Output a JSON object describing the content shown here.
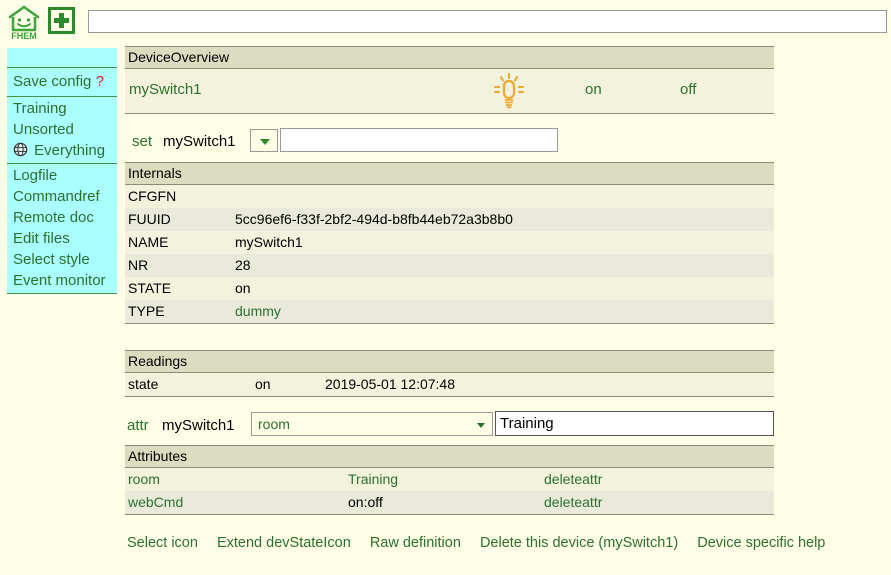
{
  "topbar": {
    "logo_text": "FHEM",
    "logo_icon": "fhem-house-smiley-icon",
    "add_icon": "plus-icon",
    "command_input_value": "",
    "command_input_placeholder": ""
  },
  "sidebar": {
    "save": {
      "label": "Save config",
      "help": "?"
    },
    "rooms": [
      {
        "label": "Training",
        "icon": ""
      },
      {
        "label": "Unsorted",
        "icon": ""
      },
      {
        "label": "Everything",
        "icon": "globe-icon"
      }
    ],
    "tools": [
      {
        "label": "Logfile"
      },
      {
        "label": "Commandref"
      },
      {
        "label": "Remote doc"
      },
      {
        "label": "Edit files"
      },
      {
        "label": "Select style"
      },
      {
        "label": "Event monitor"
      }
    ]
  },
  "device_overview": {
    "title": "DeviceOverview",
    "device_name": "mySwitch1",
    "state_icon": "lightbulb-on-icon",
    "state_icon_color": "#f0a830",
    "commands": [
      {
        "label": "on"
      },
      {
        "label": "off"
      }
    ]
  },
  "set_row": {
    "keyword": "set",
    "device_name": "mySwitch1",
    "select_value": "",
    "input_value": "",
    "input_placeholder": ""
  },
  "internals": {
    "title": "Internals",
    "rows": [
      {
        "key": "CFGFN",
        "value": ""
      },
      {
        "key": "FUUID",
        "value": "5cc96ef6-f33f-2bf2-494d-b8fb44eb72a3b8b0"
      },
      {
        "key": "NAME",
        "value": "mySwitch1"
      },
      {
        "key": "NR",
        "value": "28"
      },
      {
        "key": "STATE",
        "value": "on"
      },
      {
        "key": "TYPE",
        "value": "dummy"
      }
    ]
  },
  "readings": {
    "title": "Readings",
    "rows": [
      {
        "name": "state",
        "value": "on",
        "timestamp": "2019-05-01 12:07:48"
      }
    ]
  },
  "attr_row": {
    "keyword": "attr",
    "device_name": "mySwitch1",
    "select_value": "room",
    "input_value": "Training"
  },
  "attributes": {
    "title": "Attributes",
    "rows": [
      {
        "name": "room",
        "value": "Training",
        "action": "deleteattr"
      },
      {
        "name": "webCmd",
        "value": "on:off",
        "action": "deleteattr"
      }
    ]
  },
  "bottom_links": [
    {
      "label": "Select icon"
    },
    {
      "label": "Extend devStateIcon"
    },
    {
      "label": "Raw definition"
    },
    {
      "label": "Delete this device (mySwitch1)"
    },
    {
      "label": "Device specific help"
    }
  ],
  "colors": {
    "page_background": "#ffffe7",
    "sidebar_background": "#aaffff",
    "link_green": "#2e7031",
    "panel_header": "#dcdcc0",
    "row_light": "#f2f2dd",
    "row_dark": "#eaeada",
    "accent_red": "#e02020"
  }
}
